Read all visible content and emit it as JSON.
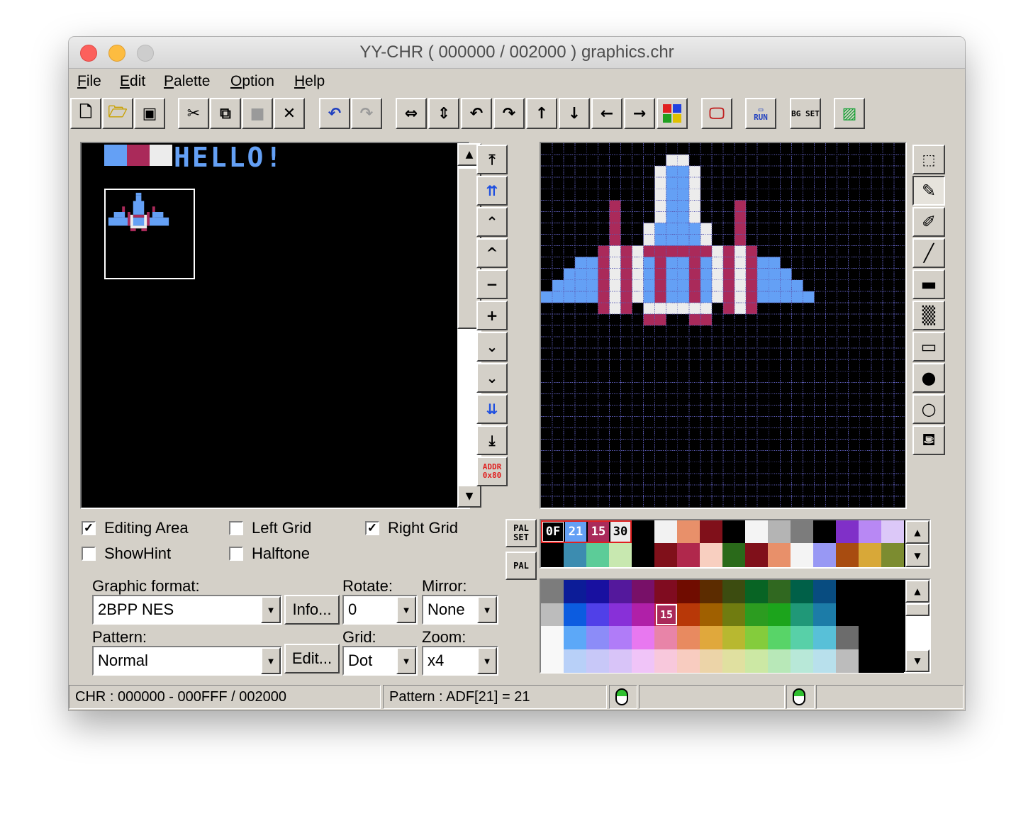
{
  "window": {
    "title": "YY-CHR ( 000000 / 002000 ) graphics.chr"
  },
  "menu": [
    {
      "key": "F",
      "rest": "ile"
    },
    {
      "key": "E",
      "rest": "dit"
    },
    {
      "key": "P",
      "rest": "alette"
    },
    {
      "key": "O",
      "rest": "ption"
    },
    {
      "key": "H",
      "rest": "elp"
    }
  ],
  "toolbar": {
    "new_icon": "new-file-icon",
    "open_icon": "open-folder-icon",
    "save_icon": "save-disk-icon",
    "cut_icon": "scissors-icon",
    "copy_icon": "copy-icon",
    "paste_icon": "paste-icon",
    "clear_icon": "clear-x-icon",
    "undo_icon": "undo-icon",
    "redo_icon": "redo-icon",
    "run_label": "RUN",
    "bgset_label": "BG SET"
  },
  "left_view": {
    "text": "HELLO!"
  },
  "nav": {
    "addr_label": "ADDR 0x80"
  },
  "checkboxes": {
    "editing_area": {
      "label": "Editing Area",
      "checked": true
    },
    "left_grid": {
      "label": "Left Grid",
      "checked": false
    },
    "right_grid": {
      "label": "Right Grid",
      "checked": true
    },
    "show_hint": {
      "label": "ShowHint",
      "checked": false
    },
    "halftone": {
      "label": "Halftone",
      "checked": false
    }
  },
  "settings": {
    "graphic_format_label": "Graphic format:",
    "graphic_format_value": "2BPP NES",
    "info_button": "Info...",
    "rotate_label": "Rotate:",
    "rotate_value": "0",
    "mirror_label": "Mirror:",
    "mirror_value": "None",
    "pattern_label": "Pattern:",
    "pattern_value": "Normal",
    "edit_button": "Edit...",
    "grid_label": "Grid:",
    "grid_value": "Dot",
    "zoom_label": "Zoom:",
    "zoom_value": "x4"
  },
  "palette": {
    "palset_label": "PAL SET",
    "pal_label": "PAL",
    "active": [
      "0F",
      "21",
      "15",
      "30"
    ],
    "selected_master": "15",
    "colors": {
      "bg": "#000000",
      "blue": "#64a0f5",
      "magenta": "#aa2a5a",
      "white": "#ececec"
    }
  },
  "status": {
    "chr": "CHR : 000000 - 000FFF / 002000",
    "pattern": "Pattern : ADF[21] = 21"
  }
}
